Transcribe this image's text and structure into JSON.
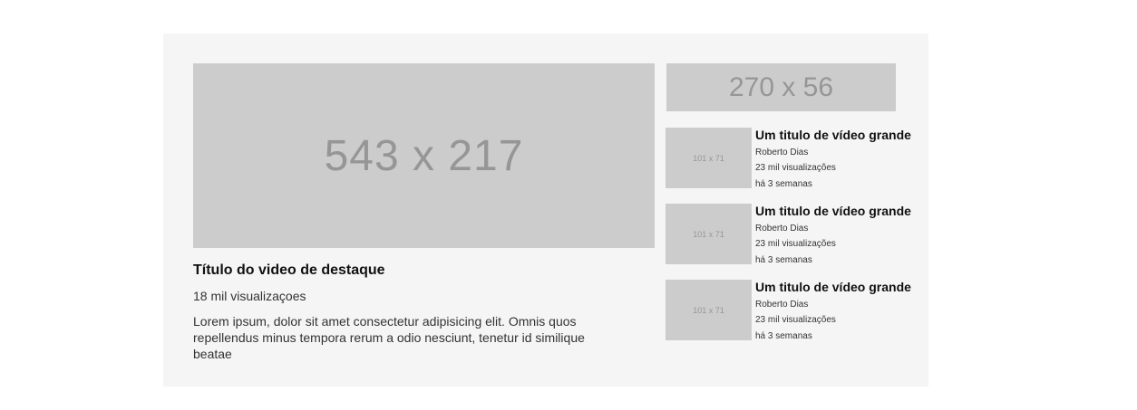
{
  "featured": {
    "thumbnail_label": "543 x 217",
    "title": "Título do video de destaque",
    "views": "18 mil visualizaçoes",
    "description": "Lorem ipsum, dolor sit amet consectetur adipisicing elit. Omnis quos repellendus minus tempora rerum a odio nesciunt, tenetur id similique beatae"
  },
  "ad_banner": {
    "label": "270 x 56"
  },
  "sidebar": {
    "items": [
      {
        "thumbnail_label": "101 x 71",
        "title": "Um titulo de vídeo grande",
        "author": "Roberto Dias",
        "views": "23 mil visualizações",
        "age": "há 3 semanas"
      },
      {
        "thumbnail_label": "101 x 71",
        "title": "Um titulo de vídeo grande",
        "author": "Roberto Dias",
        "views": "23 mil visualizações",
        "age": "há 3 semanas"
      },
      {
        "thumbnail_label": "101 x 71",
        "title": "Um titulo de vídeo grande",
        "author": "Roberto Dias",
        "views": "23 mil visualizações",
        "age": "há 3 semanas"
      }
    ]
  },
  "colors": {
    "panel_background": "#f5f5f5",
    "placeholder_background": "#cccccc",
    "placeholder_text": "#969696"
  }
}
